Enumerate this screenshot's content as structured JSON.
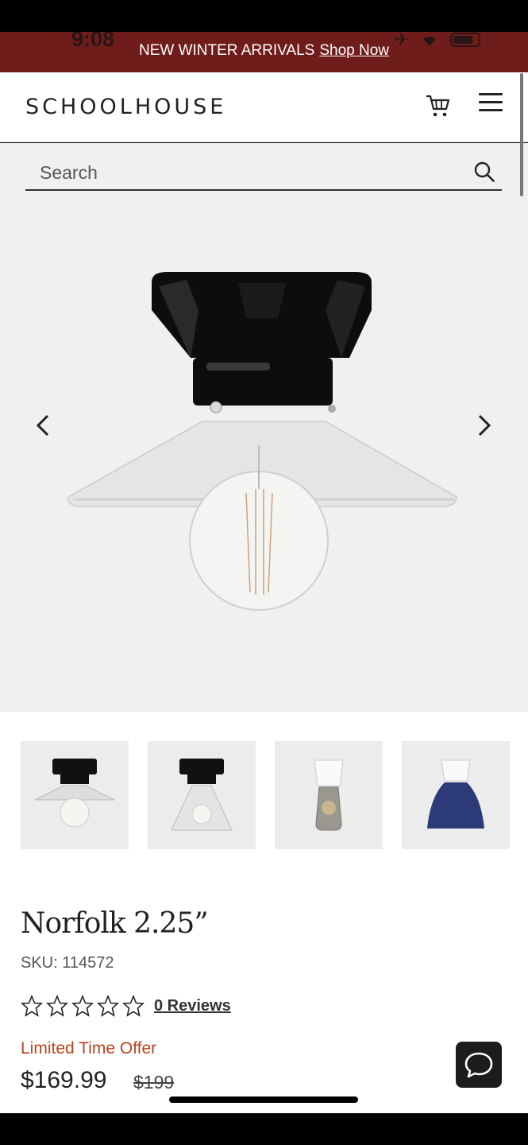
{
  "status": {
    "time": "9:08"
  },
  "promo": {
    "text": "NEW WINTER ARRIVALS",
    "link": "Shop Now"
  },
  "header": {
    "logo": "SCHOOLHOUSE"
  },
  "search": {
    "placeholder": "Search"
  },
  "product": {
    "title": "Norfolk 2.25”",
    "sku": "SKU: 114572",
    "reviews_link": "0 Reviews",
    "rating": 0,
    "offer_label": "Limited Time Offer",
    "price": "$169.99",
    "original_price": "$199"
  },
  "thumbnails": [
    {
      "name": "black-ceiling-clear-cone-shade"
    },
    {
      "name": "black-ceiling-clear-bell-shade"
    },
    {
      "name": "white-ceiling-smoke-glass-shade"
    },
    {
      "name": "white-ceiling-navy-dome-shade"
    }
  ],
  "colors": {
    "promo_bg": "#6f1d1b",
    "offer_text": "#b5441c",
    "hero_bg": "#f0f0f0"
  }
}
